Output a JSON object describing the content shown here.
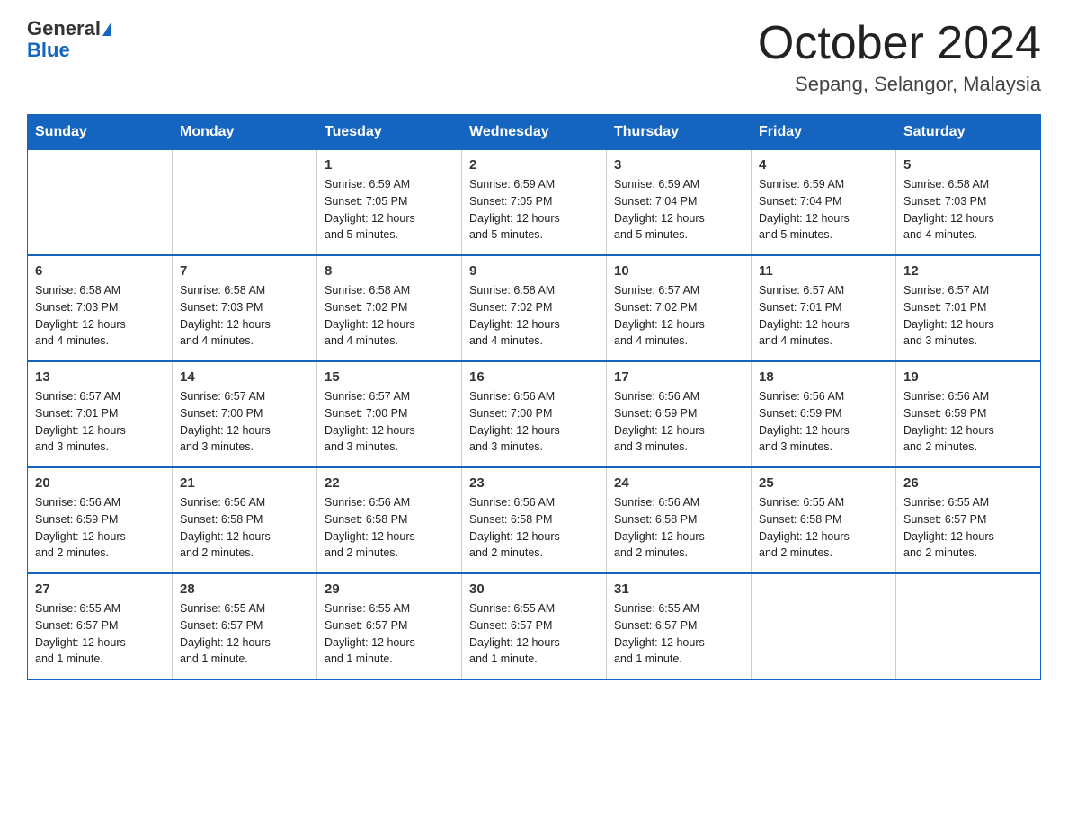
{
  "logo": {
    "general": "General",
    "blue": "Blue",
    "triangle": "▶"
  },
  "title": "October 2024",
  "location": "Sepang, Selangor, Malaysia",
  "days_of_week": [
    "Sunday",
    "Monday",
    "Tuesday",
    "Wednesday",
    "Thursday",
    "Friday",
    "Saturday"
  ],
  "weeks": [
    [
      {
        "day": "",
        "info": ""
      },
      {
        "day": "",
        "info": ""
      },
      {
        "day": "1",
        "info": "Sunrise: 6:59 AM\nSunset: 7:05 PM\nDaylight: 12 hours\nand 5 minutes."
      },
      {
        "day": "2",
        "info": "Sunrise: 6:59 AM\nSunset: 7:05 PM\nDaylight: 12 hours\nand 5 minutes."
      },
      {
        "day": "3",
        "info": "Sunrise: 6:59 AM\nSunset: 7:04 PM\nDaylight: 12 hours\nand 5 minutes."
      },
      {
        "day": "4",
        "info": "Sunrise: 6:59 AM\nSunset: 7:04 PM\nDaylight: 12 hours\nand 5 minutes."
      },
      {
        "day": "5",
        "info": "Sunrise: 6:58 AM\nSunset: 7:03 PM\nDaylight: 12 hours\nand 4 minutes."
      }
    ],
    [
      {
        "day": "6",
        "info": "Sunrise: 6:58 AM\nSunset: 7:03 PM\nDaylight: 12 hours\nand 4 minutes."
      },
      {
        "day": "7",
        "info": "Sunrise: 6:58 AM\nSunset: 7:03 PM\nDaylight: 12 hours\nand 4 minutes."
      },
      {
        "day": "8",
        "info": "Sunrise: 6:58 AM\nSunset: 7:02 PM\nDaylight: 12 hours\nand 4 minutes."
      },
      {
        "day": "9",
        "info": "Sunrise: 6:58 AM\nSunset: 7:02 PM\nDaylight: 12 hours\nand 4 minutes."
      },
      {
        "day": "10",
        "info": "Sunrise: 6:57 AM\nSunset: 7:02 PM\nDaylight: 12 hours\nand 4 minutes."
      },
      {
        "day": "11",
        "info": "Sunrise: 6:57 AM\nSunset: 7:01 PM\nDaylight: 12 hours\nand 4 minutes."
      },
      {
        "day": "12",
        "info": "Sunrise: 6:57 AM\nSunset: 7:01 PM\nDaylight: 12 hours\nand 3 minutes."
      }
    ],
    [
      {
        "day": "13",
        "info": "Sunrise: 6:57 AM\nSunset: 7:01 PM\nDaylight: 12 hours\nand 3 minutes."
      },
      {
        "day": "14",
        "info": "Sunrise: 6:57 AM\nSunset: 7:00 PM\nDaylight: 12 hours\nand 3 minutes."
      },
      {
        "day": "15",
        "info": "Sunrise: 6:57 AM\nSunset: 7:00 PM\nDaylight: 12 hours\nand 3 minutes."
      },
      {
        "day": "16",
        "info": "Sunrise: 6:56 AM\nSunset: 7:00 PM\nDaylight: 12 hours\nand 3 minutes."
      },
      {
        "day": "17",
        "info": "Sunrise: 6:56 AM\nSunset: 6:59 PM\nDaylight: 12 hours\nand 3 minutes."
      },
      {
        "day": "18",
        "info": "Sunrise: 6:56 AM\nSunset: 6:59 PM\nDaylight: 12 hours\nand 3 minutes."
      },
      {
        "day": "19",
        "info": "Sunrise: 6:56 AM\nSunset: 6:59 PM\nDaylight: 12 hours\nand 2 minutes."
      }
    ],
    [
      {
        "day": "20",
        "info": "Sunrise: 6:56 AM\nSunset: 6:59 PM\nDaylight: 12 hours\nand 2 minutes."
      },
      {
        "day": "21",
        "info": "Sunrise: 6:56 AM\nSunset: 6:58 PM\nDaylight: 12 hours\nand 2 minutes."
      },
      {
        "day": "22",
        "info": "Sunrise: 6:56 AM\nSunset: 6:58 PM\nDaylight: 12 hours\nand 2 minutes."
      },
      {
        "day": "23",
        "info": "Sunrise: 6:56 AM\nSunset: 6:58 PM\nDaylight: 12 hours\nand 2 minutes."
      },
      {
        "day": "24",
        "info": "Sunrise: 6:56 AM\nSunset: 6:58 PM\nDaylight: 12 hours\nand 2 minutes."
      },
      {
        "day": "25",
        "info": "Sunrise: 6:55 AM\nSunset: 6:58 PM\nDaylight: 12 hours\nand 2 minutes."
      },
      {
        "day": "26",
        "info": "Sunrise: 6:55 AM\nSunset: 6:57 PM\nDaylight: 12 hours\nand 2 minutes."
      }
    ],
    [
      {
        "day": "27",
        "info": "Sunrise: 6:55 AM\nSunset: 6:57 PM\nDaylight: 12 hours\nand 1 minute."
      },
      {
        "day": "28",
        "info": "Sunrise: 6:55 AM\nSunset: 6:57 PM\nDaylight: 12 hours\nand 1 minute."
      },
      {
        "day": "29",
        "info": "Sunrise: 6:55 AM\nSunset: 6:57 PM\nDaylight: 12 hours\nand 1 minute."
      },
      {
        "day": "30",
        "info": "Sunrise: 6:55 AM\nSunset: 6:57 PM\nDaylight: 12 hours\nand 1 minute."
      },
      {
        "day": "31",
        "info": "Sunrise: 6:55 AM\nSunset: 6:57 PM\nDaylight: 12 hours\nand 1 minute."
      },
      {
        "day": "",
        "info": ""
      },
      {
        "day": "",
        "info": ""
      }
    ]
  ]
}
